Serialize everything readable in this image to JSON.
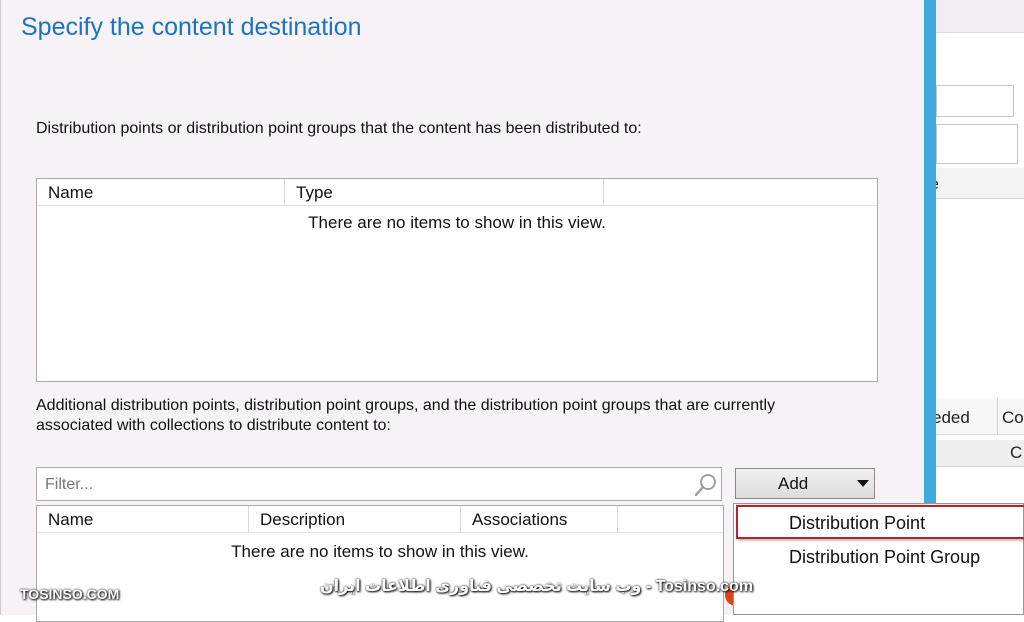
{
  "dialog": {
    "title": "Specify the content destination",
    "distributed_label": "Distribution points or distribution point groups that the content has been distributed to:",
    "additional_label": "Additional distribution points, distribution point groups, and the distribution point groups that are currently associated with collections to distribute content to:"
  },
  "list1": {
    "columns": [
      "Name",
      "Type"
    ],
    "empty_text": "There are no items to show in this view."
  },
  "filter": {
    "placeholder": "Filter..."
  },
  "add_button": {
    "label": "Add"
  },
  "add_menu": {
    "items": [
      "Distribution Point",
      "Distribution Point Group"
    ]
  },
  "list2": {
    "columns": [
      "Name",
      "Description",
      "Associations"
    ],
    "empty_text": "There are no items to show in this view."
  },
  "background": {
    "header_fragment": "e",
    "col_a": "eded",
    "col_b": "Co",
    "row_fragment": "C"
  },
  "watermark": {
    "center_text": "وب سایت تخصصی فناوری اطلاعات ایران - Tosinso.com",
    "left_text": "TOSINSO.COM"
  },
  "colors": {
    "title": "#1a73c4",
    "accent_strip": "#3fa9dd",
    "highlight_border": "#b8222a",
    "warning": "#e0431d"
  },
  "icons": {
    "filter": "search-icon",
    "dropdown": "caret-down-icon",
    "warning": "warning-icon"
  }
}
